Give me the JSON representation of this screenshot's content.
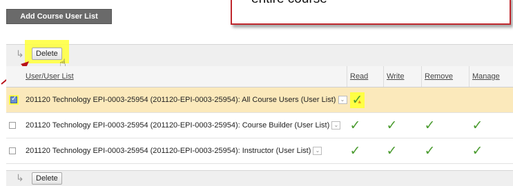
{
  "toolbar": {
    "add_button_label": "Add Course User List"
  },
  "callout": {
    "text": "entire course"
  },
  "actions": {
    "delete_label": "Delete"
  },
  "table": {
    "headers": {
      "name": "User/User List",
      "read": "Read",
      "write": "Write",
      "remove": "Remove",
      "manage": "Manage"
    },
    "rows": [
      {
        "name": "201120 Technology EPI-0003-25954 (201120-EPI-0003-25954): All Course Users (User List)",
        "checked": true,
        "permissions": {
          "read": true,
          "write": false,
          "remove": false,
          "manage": false
        }
      },
      {
        "name": "201120 Technology EPI-0003-25954 (201120-EPI-0003-25954): Course Builder (User List)",
        "checked": false,
        "permissions": {
          "read": true,
          "write": true,
          "remove": true,
          "manage": true
        }
      },
      {
        "name": "201120 Technology EPI-0003-25954 (201120-EPI-0003-25954): Instructor (User List)",
        "checked": false,
        "permissions": {
          "read": true,
          "write": true,
          "remove": true,
          "manage": true
        }
      }
    ]
  },
  "icons": {
    "check_mark": "check-icon",
    "row_menu": "chevron-down-icon",
    "pointer": "hand-pointer-icon",
    "annotation_arrow": "red-arrow-icon"
  },
  "colors": {
    "highlight": "#ffff44",
    "selected_row": "#fbe9bb",
    "check_green": "#4a9b2f",
    "callout_border": "#c0272d",
    "add_button_bg": "#6a6a6a"
  }
}
